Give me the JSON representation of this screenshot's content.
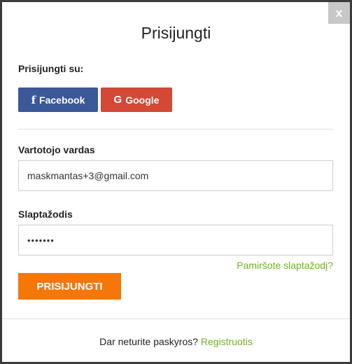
{
  "modal": {
    "close_label": "x",
    "title": "Prisijungti"
  },
  "social": {
    "label": "Prisijungti su:",
    "facebook_icon": "f",
    "facebook_label": "Facebook",
    "google_icon": "G",
    "google_label": "Google",
    "facebook_color": "#3b5998",
    "google_color": "#d34836"
  },
  "form": {
    "username_label": "Vartotojo vardas",
    "username_value": "maskmantas+3@gmail.com",
    "password_label": "Slaptažodis",
    "password_value": "•••••••",
    "forgot_link": "Pamiršote slaptažodį?",
    "submit_label": "PRISIJUNGTI",
    "submit_color": "#f57609",
    "link_color": "#6db31f"
  },
  "footer": {
    "text": "Dar neturite paskyros?",
    "register_link": "Registruotis"
  }
}
